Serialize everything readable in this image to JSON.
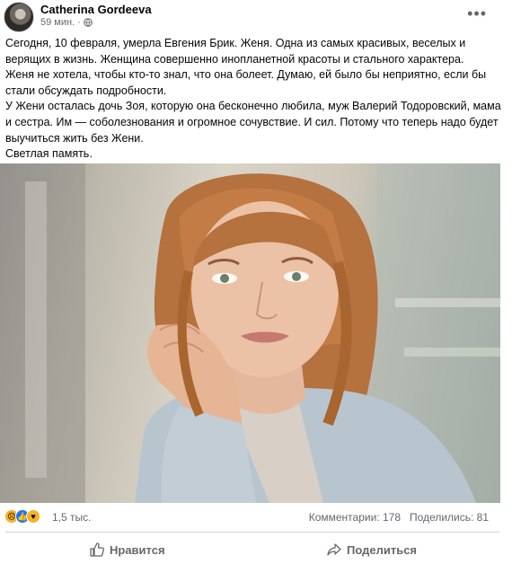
{
  "post": {
    "author": "Catherina Gordeeva",
    "time": "59 мин.",
    "meta_separator": "·",
    "more_label": "•••",
    "paragraphs": [
      "Сегодня, 10 февраля, умерла Евгения Брик. Женя. Одна из самых красивых, веселых и верящих в жизнь. Женщина совершенно инопланетной красоты и стального характера.",
      "Женя не хотела, чтобы кто-то знал, что она болеет. Думаю, ей было бы неприятно, если бы стали обсуждать подробности.",
      "У Жени осталась дочь Зоя, которую она бесконечно любила, муж Валерий Тодоровский, мама и сестра. Им — соболезнования и огромное сочувствие. И сил. Потому что теперь надо будет выучиться жить без Жени.",
      "Светлая память."
    ]
  },
  "stats": {
    "reaction_icons": [
      "sad-reaction-icon",
      "like-reaction-icon",
      "care-reaction-icon"
    ],
    "reaction_count": "1,5 тыс.",
    "comments": "Комментарии: 178",
    "shares": "Поделились: 81"
  },
  "actions": {
    "like_label": "Нравится",
    "share_label": "Поделиться"
  },
  "colors": {
    "secondary_text": "#65676b",
    "like_blue": "#1877f2",
    "divider": "#ced0d4"
  }
}
